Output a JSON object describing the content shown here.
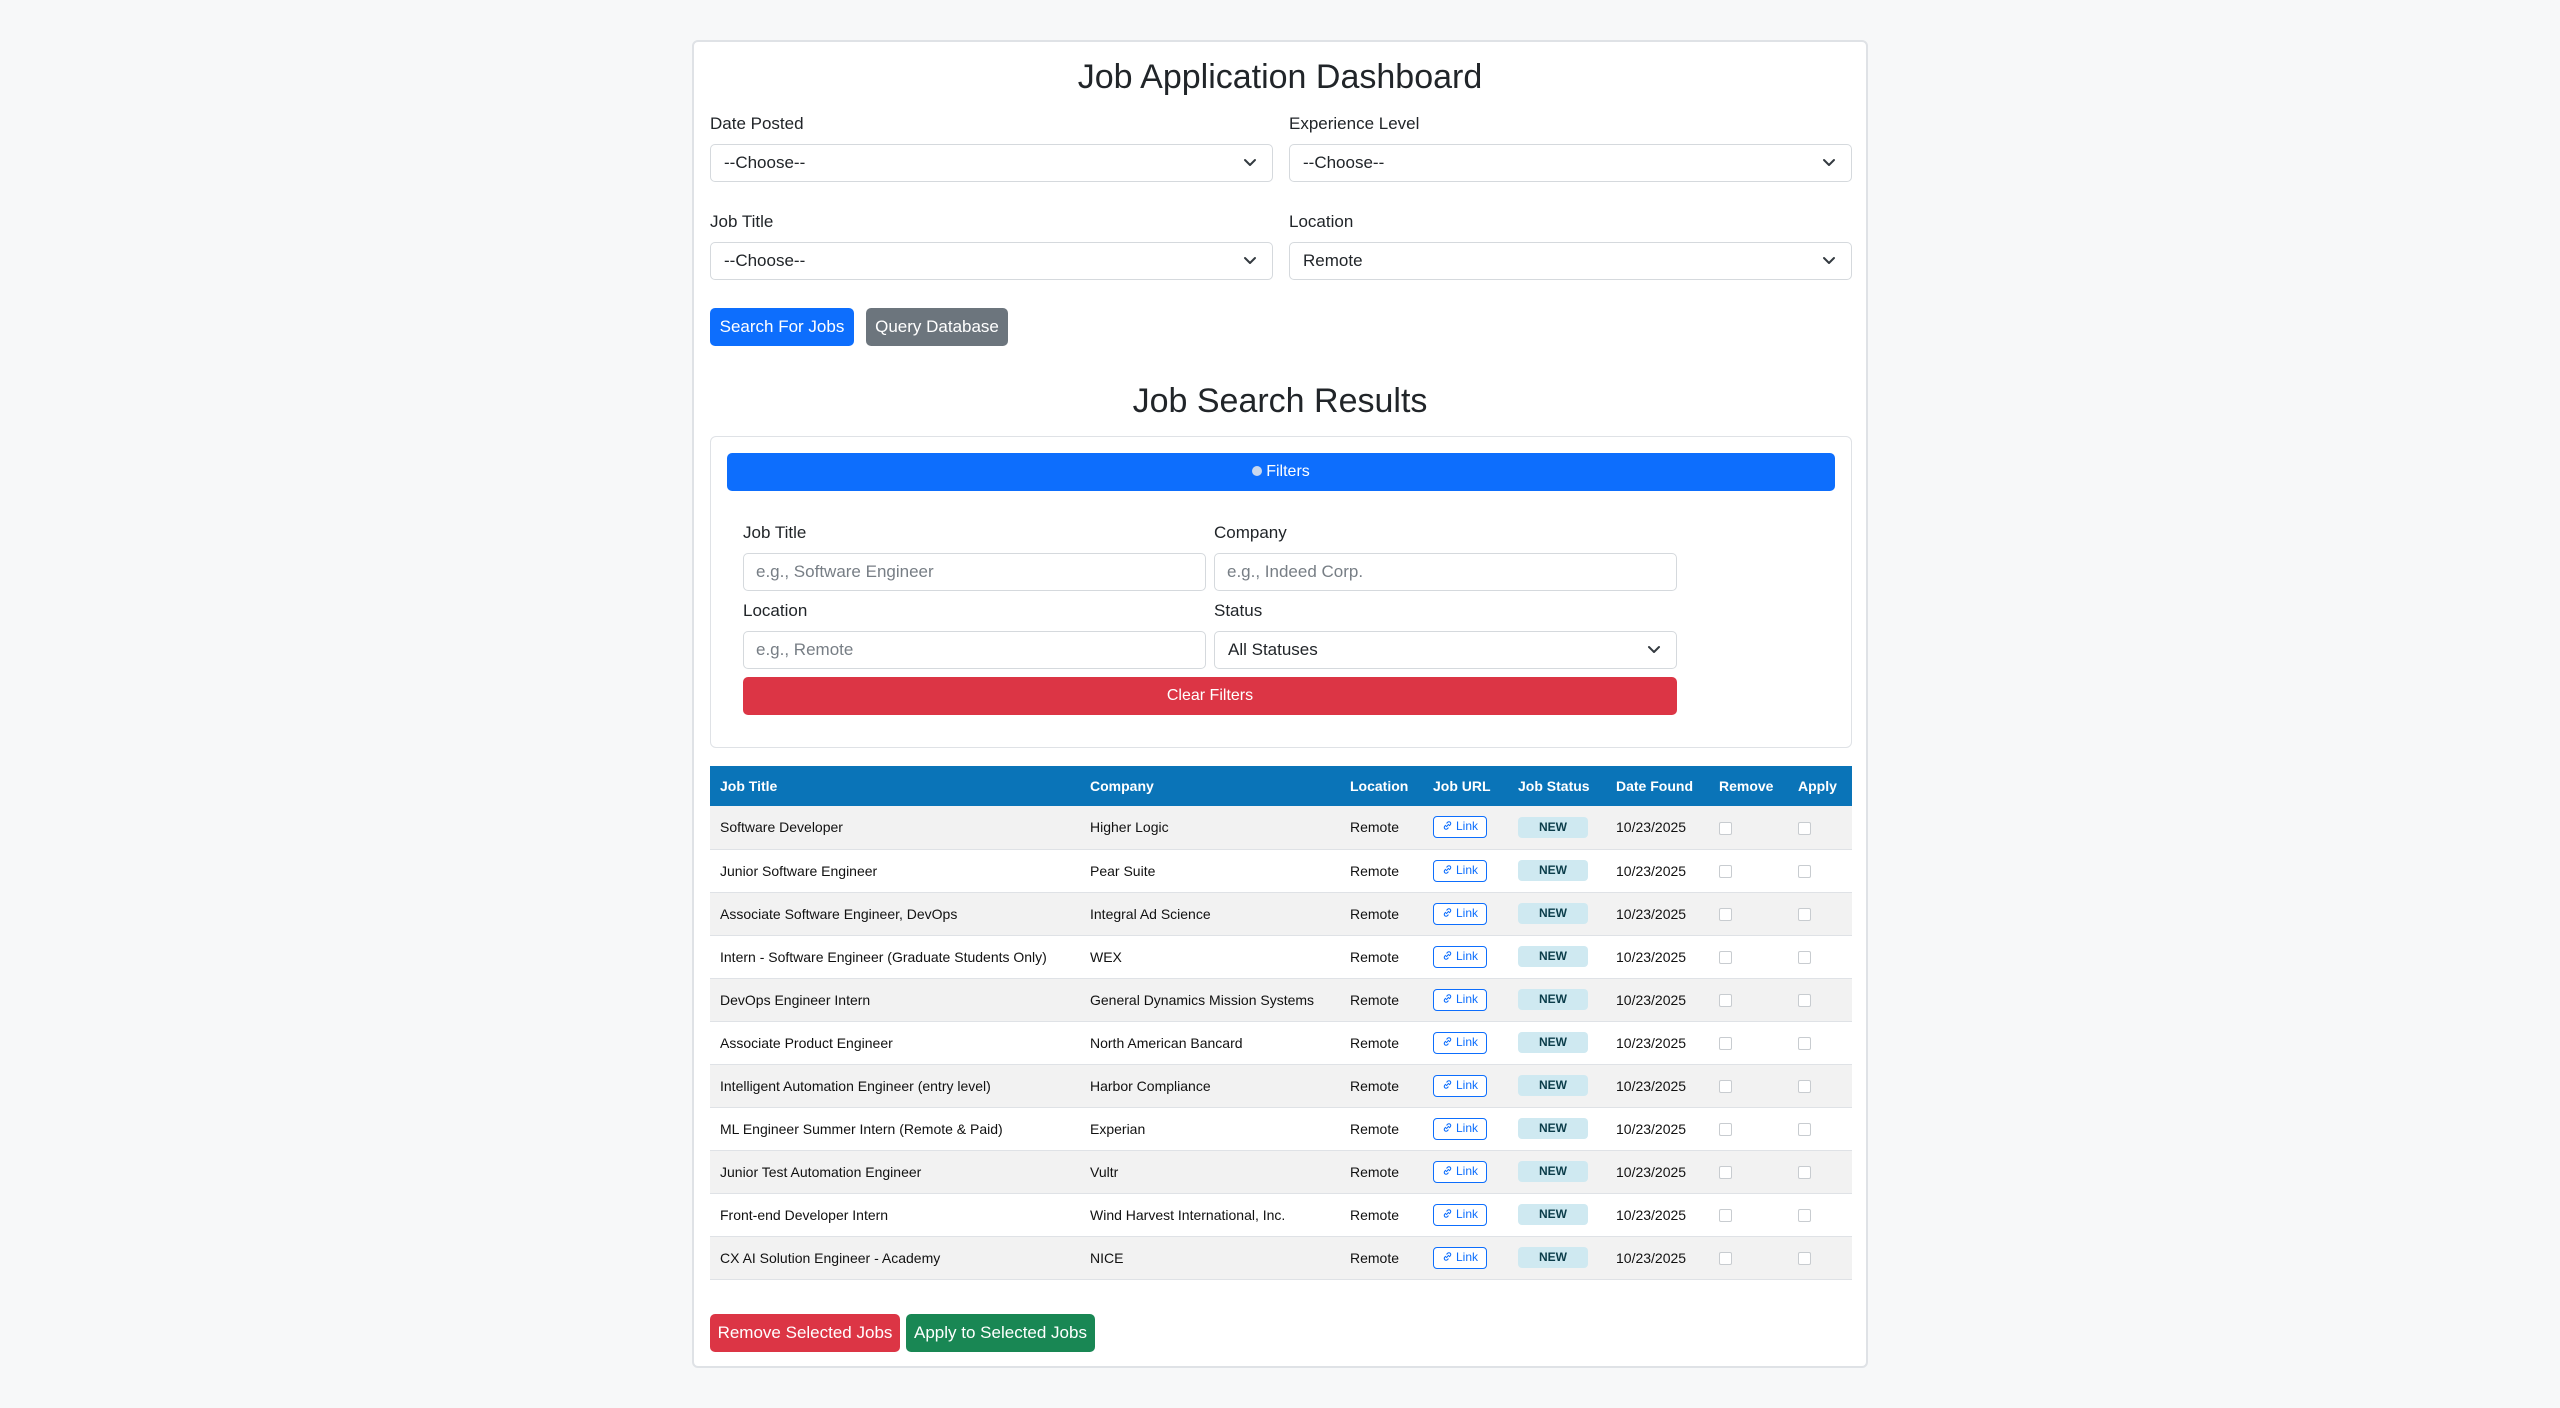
{
  "dashboard": {
    "title": "Job Application Dashboard",
    "date_posted": {
      "label": "Date Posted",
      "value": "--Choose--"
    },
    "experience_level": {
      "label": "Experience Level",
      "value": "--Choose--"
    },
    "job_title": {
      "label": "Job Title",
      "value": "--Choose--"
    },
    "location": {
      "label": "Location",
      "value": "Remote"
    },
    "search_button": "Search For Jobs",
    "query_button": "Query Database"
  },
  "results": {
    "title": "Job Search Results",
    "filters_button": "Filters",
    "filters": {
      "job_title": {
        "label": "Job Title",
        "placeholder": "e.g., Software Engineer"
      },
      "company": {
        "label": "Company",
        "placeholder": "e.g., Indeed Corp."
      },
      "location": {
        "label": "Location",
        "placeholder": "e.g., Remote"
      },
      "status": {
        "label": "Status",
        "value": "All Statuses"
      },
      "clear_button": "Clear Filters"
    },
    "table": {
      "headers": [
        "Job Title",
        "Company",
        "Location",
        "Job URL",
        "Job Status",
        "Date Found",
        "Remove",
        "Apply"
      ],
      "rows": [
        {
          "title": "Software Developer",
          "company": "Higher Logic",
          "location": "Remote",
          "url": "Link",
          "status": "NEW",
          "date": "10/23/2025"
        },
        {
          "title": "Junior Software Engineer",
          "company": "Pear Suite",
          "location": "Remote",
          "url": "Link",
          "status": "NEW",
          "date": "10/23/2025"
        },
        {
          "title": "Associate Software Engineer, DevOps",
          "company": "Integral Ad Science",
          "location": "Remote",
          "url": "Link",
          "status": "NEW",
          "date": "10/23/2025"
        },
        {
          "title": "Intern - Software Engineer (Graduate Students Only)",
          "company": "WEX",
          "location": "Remote",
          "url": "Link",
          "status": "NEW",
          "date": "10/23/2025"
        },
        {
          "title": "DevOps Engineer Intern",
          "company": "General Dynamics Mission Systems",
          "location": "Remote",
          "url": "Link",
          "status": "NEW",
          "date": "10/23/2025"
        },
        {
          "title": "Associate Product Engineer",
          "company": "North American Bancard",
          "location": "Remote",
          "url": "Link",
          "status": "NEW",
          "date": "10/23/2025"
        },
        {
          "title": "Intelligent Automation Engineer (entry level)",
          "company": "Harbor Compliance",
          "location": "Remote",
          "url": "Link",
          "status": "NEW",
          "date": "10/23/2025"
        },
        {
          "title": "ML Engineer Summer Intern (Remote & Paid)",
          "company": "Experian",
          "location": "Remote",
          "url": "Link",
          "status": "NEW",
          "date": "10/23/2025"
        },
        {
          "title": "Junior Test Automation Engineer",
          "company": "Vultr",
          "location": "Remote",
          "url": "Link",
          "status": "NEW",
          "date": "10/23/2025"
        },
        {
          "title": "Front-end Developer Intern",
          "company": "Wind Harvest International, Inc.",
          "location": "Remote",
          "url": "Link",
          "status": "NEW",
          "date": "10/23/2025"
        },
        {
          "title": "CX AI Solution Engineer - Academy",
          "company": "NICE",
          "location": "Remote",
          "url": "Link",
          "status": "NEW",
          "date": "10/23/2025"
        }
      ]
    },
    "remove_selected_button": "Remove Selected Jobs",
    "apply_selected_button": "Apply to Selected Jobs"
  },
  "colors": {
    "primary": "#0d6efd",
    "secondary": "#6c757d",
    "danger": "#dc3545",
    "success": "#198754",
    "table_header": "#0a74b8",
    "badge_bg": "#cfe9f1"
  },
  "icons": {
    "select_chevron": "chevron-down-icon",
    "filters": "dot-icon",
    "link": "link-icon"
  }
}
